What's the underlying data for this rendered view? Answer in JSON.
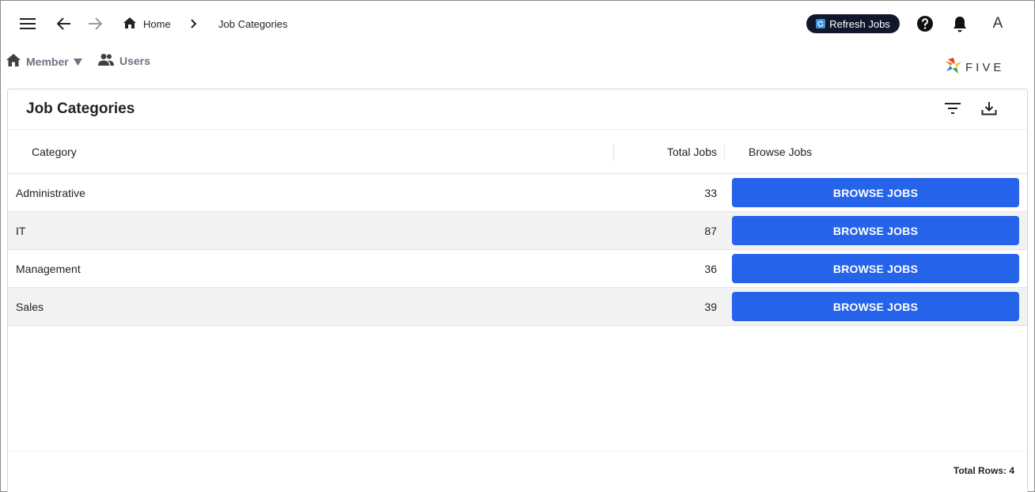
{
  "topbar": {
    "breadcrumb_home": "Home",
    "breadcrumb_current": "Job Categories",
    "refresh_label": "Refresh Jobs",
    "avatar_letter": "A"
  },
  "menubar": {
    "items": [
      {
        "label": "Member",
        "icon": "home-icon",
        "has_dropdown": true
      },
      {
        "label": "Users",
        "icon": "users-icon"
      }
    ],
    "logo_text": "FIVE"
  },
  "panel": {
    "title": "Job Categories",
    "columns": [
      "Category",
      "Total Jobs",
      "Browse Jobs"
    ],
    "rows": [
      {
        "category": "Administrative",
        "total": "33",
        "action": "BROWSE JOBS"
      },
      {
        "category": "IT",
        "total": "87",
        "action": "BROWSE JOBS"
      },
      {
        "category": "Management",
        "total": "36",
        "action": "BROWSE JOBS"
      },
      {
        "category": "Sales",
        "total": "39",
        "action": "BROWSE JOBS"
      }
    ],
    "total_rows_label": "Total Rows: 4"
  },
  "colors": {
    "accent": "#2563eb",
    "refresh_bg": "#12182b",
    "row_alt": "#f2f2f2"
  }
}
